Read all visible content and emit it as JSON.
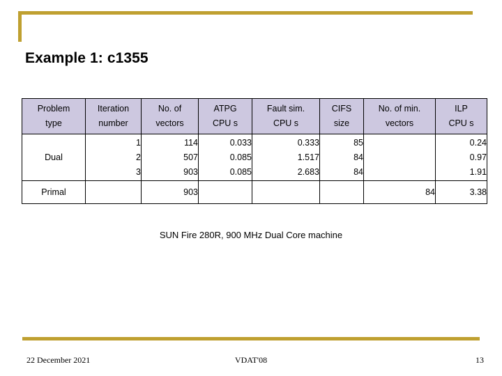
{
  "theme": {
    "accent_color": "#bfa030",
    "header_fill": "#cdc8e0",
    "border_color": "#000000",
    "text_color": "#000000",
    "background": "#ffffff"
  },
  "slide": {
    "title": "Example 1: c1355",
    "caption": "SUN Fire 280R, 900 MHz Dual Core machine"
  },
  "table": {
    "headers": [
      {
        "line1": "Problem",
        "line2": "type"
      },
      {
        "line1": "Iteration",
        "line2": "number"
      },
      {
        "line1": "No. of",
        "line2": "vectors"
      },
      {
        "line1": "ATPG",
        "line2": "CPU s"
      },
      {
        "line1": "Fault sim.",
        "line2": "CPU s"
      },
      {
        "line1": "CIFS",
        "line2": "size"
      },
      {
        "line1": "No. of min.",
        "line2": "vectors"
      },
      {
        "line1": "ILP",
        "line2": "CPU s"
      }
    ],
    "rows": [
      {
        "problem_type": "Dual",
        "iteration_number": [
          "1",
          "2",
          "3"
        ],
        "no_of_vectors": [
          "114",
          "507",
          "903"
        ],
        "atpg_cpu_s": [
          "0.033",
          "0.085",
          "0.085"
        ],
        "fault_sim_cpu_s": [
          "0.333",
          "1.517",
          "2.683"
        ],
        "cifs_size": [
          "85",
          "84",
          "84"
        ],
        "no_of_min_vectors": [
          "",
          "",
          ""
        ],
        "ilp_cpu_s": [
          "0.24",
          "0.97",
          "1.91"
        ]
      },
      {
        "problem_type": "Primal",
        "iteration_number": [
          ""
        ],
        "no_of_vectors": [
          "903"
        ],
        "atpg_cpu_s": [
          ""
        ],
        "fault_sim_cpu_s": [
          ""
        ],
        "cifs_size": [
          ""
        ],
        "no_of_min_vectors": [
          "84"
        ],
        "ilp_cpu_s": [
          "3.38"
        ]
      }
    ]
  },
  "footer": {
    "date": "22 December 2021",
    "conference": "VDAT'08",
    "page_number": "13"
  }
}
